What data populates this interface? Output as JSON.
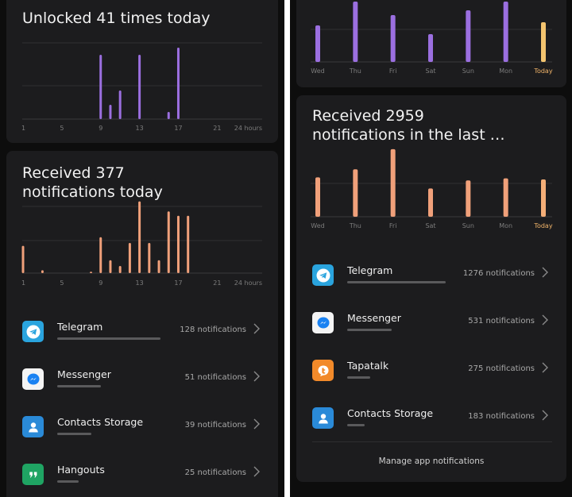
{
  "left": {
    "unlock_card": {
      "title": "Unlocked 41 times today",
      "chart_data": {
        "type": "bar",
        "x_ticks": [
          "1",
          "5",
          "9",
          "13",
          "17",
          "21",
          "24 hours"
        ],
        "x_tick_hours": [
          1,
          5,
          9,
          13,
          17,
          21,
          24
        ],
        "bars": [
          {
            "hour": 9.0,
            "value": 9
          },
          {
            "hour": 10.0,
            "value": 2
          },
          {
            "hour": 11.0,
            "value": 4
          },
          {
            "hour": 13.0,
            "value": 9
          },
          {
            "hour": 16.0,
            "value": 1
          },
          {
            "hour": 17.0,
            "value": 10
          }
        ],
        "ymax": 12,
        "bar_color": "#9b6fe0"
      }
    },
    "notif_card": {
      "title": "Received 377\nnotifications today",
      "chart_data": {
        "type": "bar",
        "x_ticks": [
          "1",
          "5",
          "9",
          "13",
          "17",
          "21",
          "24 hours"
        ],
        "x_tick_hours": [
          1,
          5,
          9,
          13,
          17,
          21,
          24
        ],
        "bars": [
          {
            "hour": 1.0,
            "value": 19
          },
          {
            "hour": 3.0,
            "value": 2
          },
          {
            "hour": 8.0,
            "value": 1
          },
          {
            "hour": 9.0,
            "value": 25
          },
          {
            "hour": 10.0,
            "value": 9
          },
          {
            "hour": 11.0,
            "value": 5
          },
          {
            "hour": 12.0,
            "value": 21
          },
          {
            "hour": 13.0,
            "value": 50
          },
          {
            "hour": 14.0,
            "value": 21
          },
          {
            "hour": 15.0,
            "value": 9
          },
          {
            "hour": 16.0,
            "value": 43
          },
          {
            "hour": 17.0,
            "value": 40
          },
          {
            "hour": 18.0,
            "value": 40
          }
        ],
        "ymax": 52,
        "bar_color": "#f0a07a"
      },
      "apps": [
        {
          "name": "Telegram",
          "count": "128 notifications",
          "share": 1.0,
          "icon": "telegram-icon",
          "color": "#2aa4de"
        },
        {
          "name": "Messenger",
          "count": "51 notifications",
          "share": 0.42,
          "icon": "messenger-icon",
          "color": "#f4f4f4"
        },
        {
          "name": "Contacts Storage",
          "count": "39 notifications",
          "share": 0.33,
          "icon": "contacts-icon",
          "color": "#2a8ad8"
        },
        {
          "name": "Hangouts",
          "count": "25 notifications",
          "share": 0.21,
          "icon": "hangouts-icon",
          "color": "#1fa463"
        }
      ]
    }
  },
  "right": {
    "week_unlock_card": {
      "chart_data": {
        "type": "bar",
        "categories": [
          "Wed",
          "Thu",
          "Fri",
          "Sat",
          "Sun",
          "Mon",
          "Today"
        ],
        "values": [
          46,
          76,
          59,
          35,
          65,
          76,
          50
        ],
        "ymax": 76,
        "bar_color": "#9b6fe0",
        "highlight_color": "#f3c46f",
        "highlight_label_color": "#f3b56a"
      }
    },
    "week_notif_card": {
      "title": "Received 2959\nnotifications in the last …",
      "chart_data": {
        "type": "bar",
        "categories": [
          "Wed",
          "Thu",
          "Fri",
          "Sat",
          "Sun",
          "Mon",
          "Today"
        ],
        "values": [
          390,
          470,
          670,
          280,
          360,
          380,
          370
        ],
        "ymax": 700,
        "bar_color": "#f0a07a",
        "highlight_color": "#f4ae78",
        "highlight_label_color": "#f3b56a"
      },
      "apps": [
        {
          "name": "Telegram",
          "count": "1276 notifications",
          "share": 1.0,
          "icon": "telegram-icon",
          "color": "#2aa4de"
        },
        {
          "name": "Messenger",
          "count": "531 notifications",
          "share": 0.45,
          "icon": "messenger-icon",
          "color": "#f4f4f4"
        },
        {
          "name": "Tapatalk",
          "count": "275 notifications",
          "share": 0.23,
          "icon": "tapatalk-icon",
          "color": "#f28a2a"
        },
        {
          "name": "Contacts Storage",
          "count": "183 notifications",
          "share": 0.15,
          "icon": "contacts-icon",
          "color": "#2a8ad8"
        }
      ],
      "manage_label": "Manage app notifications"
    }
  }
}
